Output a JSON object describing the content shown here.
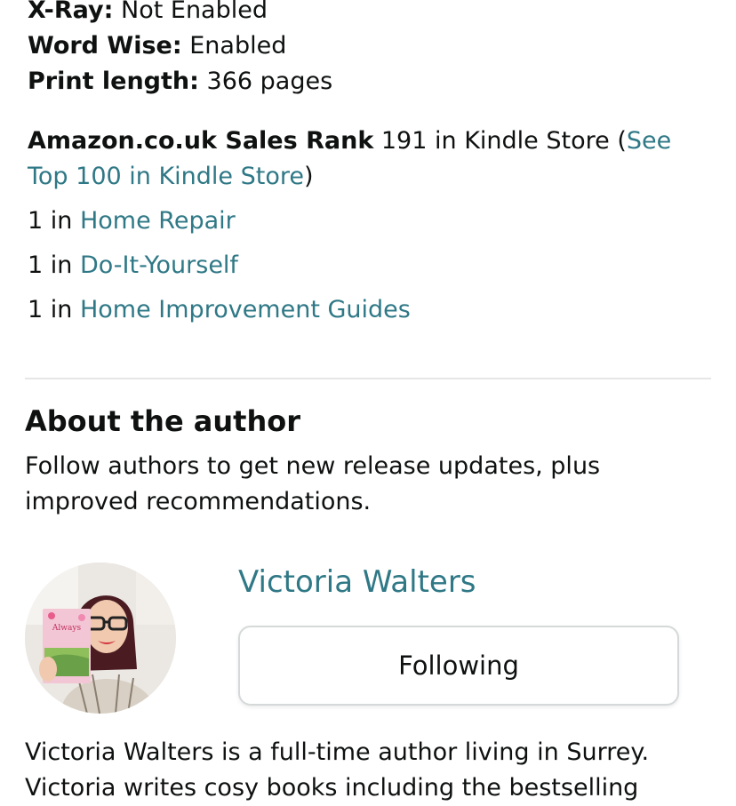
{
  "product_details": [
    {
      "label": "X-Ray:",
      "value": "Not Enabled"
    },
    {
      "label": "Word Wise:",
      "value": "Enabled"
    },
    {
      "label": "Print length:",
      "value": "366 pages"
    }
  ],
  "sales_rank": {
    "label": "Amazon.co.uk Sales Rank",
    "value": "191 in Kindle Store",
    "open_paren": "(",
    "link_text": "See Top 100 in Kindle Store",
    "close_paren": ")",
    "categories": [
      {
        "rank": "1 in",
        "category": "Home Repair"
      },
      {
        "rank": "1 in",
        "category": "Do-It-Yourself"
      },
      {
        "rank": "1 in",
        "category": "Home Improvement Guides"
      }
    ]
  },
  "about_author": {
    "title": "About the author",
    "description": "Follow authors to get new release updates, plus improved recommendations.",
    "author_name": "Victoria Walters",
    "follow_button_label": "Following",
    "bio": "Victoria Walters is a full-time author living in Surrey. Victoria writes cosy books including the bestselling"
  },
  "colors": {
    "link": "#2f7886",
    "text": "#0f1111",
    "divider": "#e6e6e6",
    "button_border": "#d5d9d9"
  }
}
